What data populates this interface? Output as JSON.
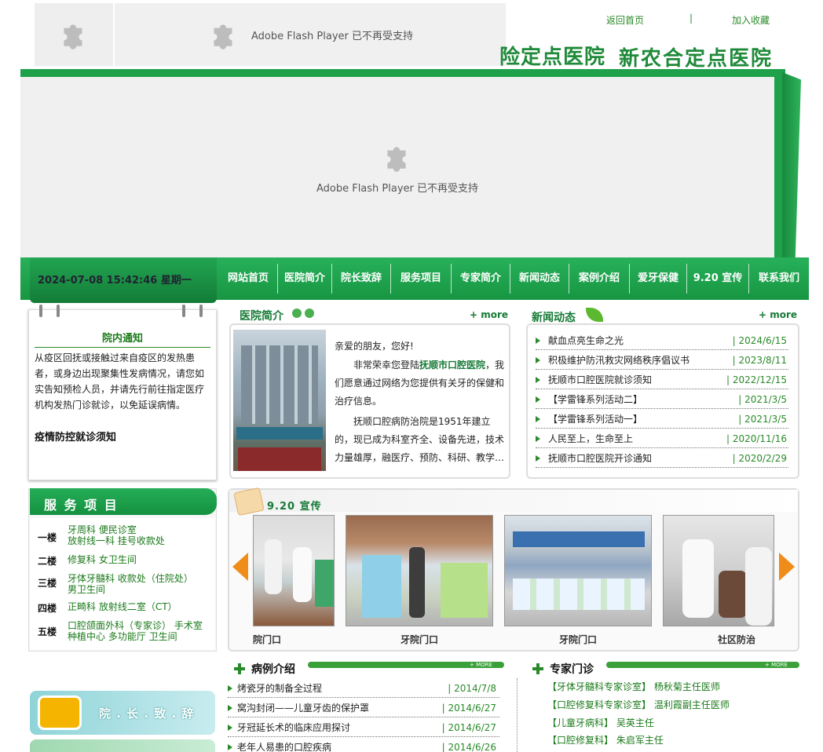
{
  "header": {
    "top_links": {
      "home": "返回首页",
      "separator": "|",
      "favorite": "加入收藏"
    },
    "banner_text_1": "险定点医院",
    "banner_text_2": "新农合定点医院",
    "flash_notice": "Adobe Flash Player 已不再受支持"
  },
  "nav": {
    "datetime": "2024-07-08 15:42:46 星期一",
    "items": [
      "网站首页",
      "医院简介",
      "院长致辞",
      "服务项目",
      "专家简介",
      "新闻动态",
      "案例介绍",
      "爱牙保健",
      "9.20 宣传",
      "联系我们"
    ]
  },
  "notice": {
    "title": "院内通知",
    "body": "从疫区回抚或接触过来自疫区的发热患者，或身边出现聚集性发病情况，请您如实告知预检人员，并请先行前往指定医疗机构发热门诊就诊，以免延误病情。",
    "link": "疫情防控就诊须知"
  },
  "intro": {
    "title": "医院简介",
    "more": "+ more",
    "greeting": "亲爱的朋友，您好!",
    "p1_pre": "非常荣幸您登陆",
    "p1_bold": "抚顺市口腔医院",
    "p1_post": "，我们愿意通过网络为您提供有关牙的保健和治疗信息。",
    "p2": "抚顺口腔病防治院是1951年建立的，现已成为科室齐全、设备先进，技术力量雄厚，融医疗、预防、科研、教学…"
  },
  "news": {
    "title": "新闻动态",
    "more": "+ more",
    "items": [
      {
        "title": "献血点亮生命之光",
        "date": "| 2024/6/15"
      },
      {
        "title": "积极维护防汛救灾网络秩序倡议书",
        "date": "| 2023/8/11"
      },
      {
        "title": "抚顺市口腔医院就诊须知",
        "date": "| 2022/12/15"
      },
      {
        "title": "【学雷锋系列活动二】",
        "date": "| 2021/3/5"
      },
      {
        "title": "【学雷锋系列活动一】",
        "date": "| 2021/3/5"
      },
      {
        "title": "人民至上，生命至上",
        "date": "| 2020/11/16"
      },
      {
        "title": "抚顺市口腔医院开诊通知",
        "date": "| 2020/2/29"
      }
    ]
  },
  "services": {
    "title": "服 务 项 目",
    "floors": [
      {
        "floor": "一楼",
        "items": [
          "牙周科  便民诊室",
          "放射线一科  挂号收款处"
        ]
      },
      {
        "floor": "二楼",
        "items": [
          "修复科  女卫生间"
        ]
      },
      {
        "floor": "三楼",
        "items": [
          "牙体牙髓科  收款处（住院处）",
          "男卫生间"
        ]
      },
      {
        "floor": "四楼",
        "items": [
          "正畸科  放射线二室（CT）"
        ]
      },
      {
        "floor": "五楼",
        "items": [
          "口腔颌面外科（专家诊）  手术室",
          "种植中心  多功能厅  卫生间"
        ]
      }
    ]
  },
  "promo": {
    "title": "9.20 宣传",
    "captions": [
      "院门口",
      "牙院门口",
      "牙院门口",
      "社区防治"
    ]
  },
  "cases": {
    "title": "病例介绍",
    "more": "+ MORE",
    "items": [
      {
        "title": "烤瓷牙的制备全过程",
        "date": "| 2014/7/8"
      },
      {
        "title": "窝沟封闭——儿童牙齿的保护罩",
        "date": "| 2014/6/27"
      },
      {
        "title": "牙冠延长术的临床应用探讨",
        "date": "| 2014/6/27"
      },
      {
        "title": "老年人易患的口腔疾病",
        "date": "| 2014/6/26"
      }
    ]
  },
  "experts": {
    "title": "专家门诊",
    "more": "+ MORE",
    "items": [
      "【牙体牙髓科专家诊室】  杨秋菊主任医师",
      "【口腔修复科专家诊室】  温利霞副主任医师",
      "【儿童牙病科】  吴英主任",
      "【口腔修复科】  朱启军主任"
    ]
  },
  "side_banner": {
    "label": "院 . 长 . 致 . 辞"
  },
  "colors": {
    "primary_green": "#1fa04a",
    "dark_green": "#167a36",
    "text_green": "#2a8a2a"
  }
}
